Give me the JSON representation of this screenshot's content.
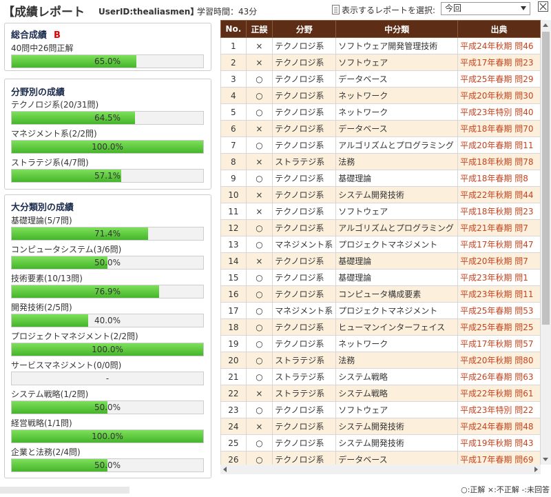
{
  "header": {
    "title": "【成績レポート",
    "user_id": "UserID:thealiasmen】",
    "study_time": "学習時間：43分",
    "select_label": "表示するレポートを選択:",
    "select_value": "今回"
  },
  "overall": {
    "title": "総合成績",
    "grade": "B",
    "summary": "40問中26問正解",
    "percent_text": "65.0%",
    "percent": 65.0
  },
  "by_field": {
    "title": "分野別の成績",
    "items": [
      {
        "label": "テクノロジ系(20/31問)",
        "percent_text": "64.5%",
        "percent": 64.5
      },
      {
        "label": "マネジメント系(2/2問)",
        "percent_text": "100.0%",
        "percent": 100.0
      },
      {
        "label": "ストラテジ系(4/7問)",
        "percent_text": "57.1%",
        "percent": 57.1
      }
    ]
  },
  "by_category": {
    "title": "大分類別の成績",
    "items": [
      {
        "label": "基礎理論(5/7問)",
        "percent_text": "71.4%",
        "percent": 71.4
      },
      {
        "label": "コンピュータシステム(3/6問)",
        "percent_text": "50.0%",
        "percent": 50.0
      },
      {
        "label": "技術要素(10/13問)",
        "percent_text": "76.9%",
        "percent": 76.9
      },
      {
        "label": "開発技術(2/5問)",
        "percent_text": "40.0%",
        "percent": 40.0
      },
      {
        "label": "プロジェクトマネジメント(2/2問)",
        "percent_text": "100.0%",
        "percent": 100.0
      },
      {
        "label": "サービスマネジメント(0/0問)",
        "percent_text": "-",
        "percent": 0
      },
      {
        "label": "システム戦略(1/2問)",
        "percent_text": "50.0%",
        "percent": 50.0
      },
      {
        "label": "経営戦略(1/1問)",
        "percent_text": "100.0%",
        "percent": 100.0
      },
      {
        "label": "企業と法務(2/4問)",
        "percent_text": "50.0%",
        "percent": 50.0
      }
    ]
  },
  "table": {
    "headers": [
      "No.",
      "正誤",
      "分野",
      "中分類",
      "出典"
    ],
    "rows": [
      {
        "no": "1",
        "mark": "×",
        "field": "テクノロジ系",
        "category": "ソフトウェア開発管理技術",
        "source": "平成24年秋期 問46"
      },
      {
        "no": "2",
        "mark": "×",
        "field": "テクノロジ系",
        "category": "ソフトウェア",
        "source": "平成17年春期 問23"
      },
      {
        "no": "3",
        "mark": "○",
        "field": "テクノロジ系",
        "category": "データベース",
        "source": "平成25年春期 問29"
      },
      {
        "no": "4",
        "mark": "○",
        "field": "テクノロジ系",
        "category": "ネットワーク",
        "source": "平成20年秋期 問30"
      },
      {
        "no": "5",
        "mark": "○",
        "field": "テクノロジ系",
        "category": "ネットワーク",
        "source": "平成23年特別 問40"
      },
      {
        "no": "6",
        "mark": "×",
        "field": "テクノロジ系",
        "category": "データベース",
        "source": "平成18年春期 問70"
      },
      {
        "no": "7",
        "mark": "○",
        "field": "テクノロジ系",
        "category": "アルゴリズムとプログラミング",
        "source": "平成20年春期 問11"
      },
      {
        "no": "8",
        "mark": "×",
        "field": "ストラテジ系",
        "category": "法務",
        "source": "平成18年秋期 問78"
      },
      {
        "no": "9",
        "mark": "○",
        "field": "テクノロジ系",
        "category": "基礎理論",
        "source": "平成18年春期 問8"
      },
      {
        "no": "10",
        "mark": "×",
        "field": "テクノロジ系",
        "category": "システム開発技術",
        "source": "平成22年秋期 問44"
      },
      {
        "no": "11",
        "mark": "×",
        "field": "テクノロジ系",
        "category": "ソフトウェア",
        "source": "平成18年秋期 問23"
      },
      {
        "no": "12",
        "mark": "○",
        "field": "テクノロジ系",
        "category": "アルゴリズムとプログラミング",
        "source": "平成21年春期 問7"
      },
      {
        "no": "13",
        "mark": "○",
        "field": "マネジメント系",
        "category": "プロジェクトマネジメント",
        "source": "平成17年秋期 問47"
      },
      {
        "no": "14",
        "mark": "×",
        "field": "テクノロジ系",
        "category": "基礎理論",
        "source": "平成20年秋期 問7"
      },
      {
        "no": "15",
        "mark": "○",
        "field": "テクノロジ系",
        "category": "基礎理論",
        "source": "平成23年秋期 問1"
      },
      {
        "no": "16",
        "mark": "○",
        "field": "テクノロジ系",
        "category": "コンピュータ構成要素",
        "source": "平成23年秋期 問11"
      },
      {
        "no": "17",
        "mark": "○",
        "field": "マネジメント系",
        "category": "プロジェクトマネジメント",
        "source": "平成25年春期 問53"
      },
      {
        "no": "18",
        "mark": "○",
        "field": "テクノロジ系",
        "category": "ヒューマンインターフェイス",
        "source": "平成25年春期 問25"
      },
      {
        "no": "19",
        "mark": "○",
        "field": "テクノロジ系",
        "category": "ネットワーク",
        "source": "平成17年秋期 問57"
      },
      {
        "no": "20",
        "mark": "○",
        "field": "ストラテジ系",
        "category": "法務",
        "source": "平成20年秋期 問80"
      },
      {
        "no": "21",
        "mark": "○",
        "field": "ストラテジ系",
        "category": "システム戦略",
        "source": "平成26年春期 問63"
      },
      {
        "no": "22",
        "mark": "×",
        "field": "ストラテジ系",
        "category": "システム戦略",
        "source": "平成22年秋期 問61"
      },
      {
        "no": "23",
        "mark": "○",
        "field": "テクノロジ系",
        "category": "ソフトウェア",
        "source": "平成23年特別 問22"
      },
      {
        "no": "24",
        "mark": "×",
        "field": "テクノロジ系",
        "category": "システム開発技術",
        "source": "平成24年春期 問48"
      },
      {
        "no": "25",
        "mark": "○",
        "field": "テクノロジ系",
        "category": "システム開発技術",
        "source": "平成19年秋期 問43"
      },
      {
        "no": "26",
        "mark": "○",
        "field": "テクノロジ系",
        "category": "データベース",
        "source": "平成17年春期 問69"
      }
    ]
  },
  "legend": "○:正解 ×:不正解 -:未回答",
  "colors": {
    "header_bg": "#5e2d15",
    "row_alt": "#fcf0dc",
    "source_text": "#c8421c",
    "grade": "#e00000",
    "bar_fill": "#45b52a"
  }
}
